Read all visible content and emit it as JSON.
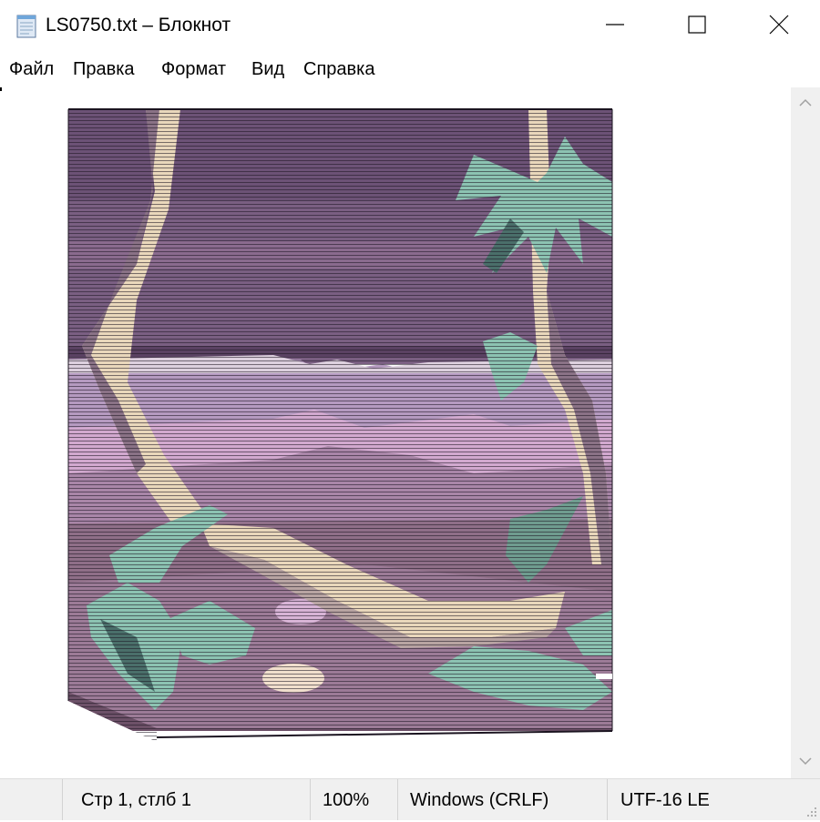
{
  "window": {
    "title": "LS0750.txt – Блокнот",
    "app_icon": "notepad-icon",
    "controls": {
      "minimize": "minimize-icon",
      "maximize": "maximize-icon",
      "close": "close-icon"
    }
  },
  "menu": {
    "items": [
      {
        "label": "Файл"
      },
      {
        "label": "Правка"
      },
      {
        "label": "Формат"
      },
      {
        "label": "Вид"
      },
      {
        "label": "Справка"
      }
    ]
  },
  "editor": {
    "content_kind": "ascii-art-scanline-image",
    "description_icon": "jungle-beach-scene"
  },
  "statusbar": {
    "position": "Стр 1, стлб 1",
    "zoom": "100%",
    "line_endings": "Windows (CRLF)",
    "encoding": "UTF-16 LE"
  },
  "colors": {
    "sky": "#7a5f82",
    "sky_dark": "#5a4262",
    "horizon_band": "#b59ac0",
    "dunes": "#d2a9cf",
    "ground": "#8f6f88",
    "trunk": "#e9d7bb",
    "trunk_shade": "#8a7286",
    "leaves": "#8cc3b2",
    "leaves_dark": "#4a6f6a",
    "outline": "#1b1420"
  }
}
